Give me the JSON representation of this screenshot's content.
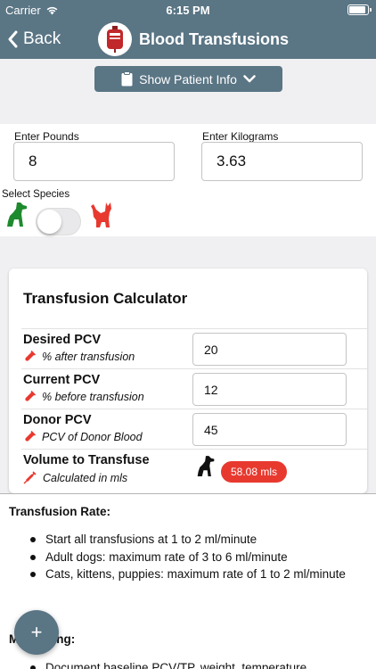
{
  "status_bar": {
    "carrier": "Carrier",
    "time": "6:15 PM",
    "battery_level": 0.9
  },
  "nav": {
    "back_label": "Back",
    "title": "Blood Transfusions"
  },
  "patient_info": {
    "label": "Show Patient Info"
  },
  "weight": {
    "pounds_label": "Enter Pounds",
    "pounds_value": "8",
    "kilograms_label": "Enter Kilograms",
    "kilograms_value": "3.63"
  },
  "species": {
    "label": "Select Species",
    "dog_icon_color": "#1e8a2e",
    "cat_icon_color": "#e8392f"
  },
  "calculator": {
    "title": "Transfusion Calculator",
    "desired": {
      "label": "Desired PCV",
      "sub": "% after transfusion",
      "value": "20"
    },
    "current": {
      "label": "Current PCV",
      "sub": "% before transfusion",
      "value": "12"
    },
    "donor": {
      "label": "Donor PCV",
      "sub": "PCV of Donor Blood",
      "value": "45"
    },
    "volume": {
      "label": "Volume to Transfuse",
      "sub": "Calculated in mls",
      "result": "58.08 mls"
    }
  },
  "info": {
    "rate_heading": "Transfusion Rate:",
    "rate_bullets": [
      "Start all transfusions at 1 to 2 ml/minute",
      "Adult dogs: maximum rate of 3 to 6 ml/minute",
      "Cats, kittens, puppies: maximum rate of 1 to 2 ml/minute"
    ],
    "monitoring_heading": "Monitoring:",
    "monitoring_bullets": [
      "Document baseline PCV/TP, weight, temperature"
    ]
  },
  "fab": {
    "label": "+"
  },
  "colors": {
    "primary": "#5a7584",
    "accent_red": "#e8392f",
    "dog_green": "#1e8a2e"
  }
}
